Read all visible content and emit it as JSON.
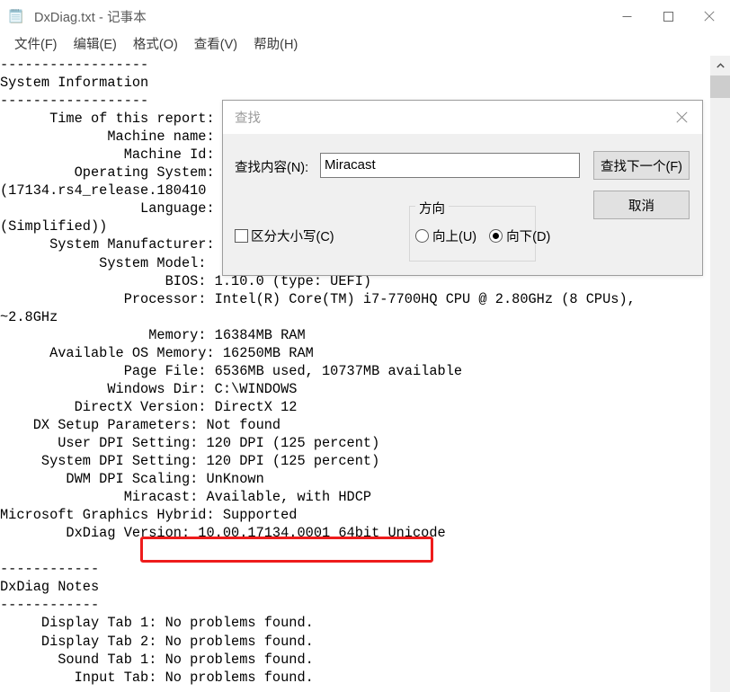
{
  "window": {
    "title": "DxDiag.txt - 记事本",
    "icon": "notepad-icon",
    "controls": {
      "minimize": "minimize-icon",
      "maximize": "maximize-icon",
      "close": "close-icon"
    }
  },
  "menubar": {
    "items": [
      {
        "label": "文件(F)"
      },
      {
        "label": "编辑(E)"
      },
      {
        "label": "格式(O)"
      },
      {
        "label": "查看(V)"
      },
      {
        "label": "帮助(H)"
      }
    ]
  },
  "document": {
    "lines": [
      "------------------",
      "System Information",
      "------------------",
      "      Time of this report:",
      "             Machine name:",
      "               Machine Id:",
      "         Operating System:",
      "(17134.rs4_release.180410",
      "                 Language:",
      "(Simplified))",
      "      System Manufacturer:",
      "            System Model:",
      "                    BIOS: 1.10.0 (type: UEFI)",
      "               Processor: Intel(R) Core(TM) i7-7700HQ CPU @ 2.80GHz (8 CPUs),",
      "~2.8GHz",
      "                  Memory: 16384MB RAM",
      "      Available OS Memory: 16250MB RAM",
      "               Page File: 6536MB used, 10737MB available",
      "             Windows Dir: C:\\WINDOWS",
      "         DirectX Version: DirectX 12",
      "    DX Setup Parameters: Not found",
      "       User DPI Setting: 120 DPI (125 percent)",
      "     System DPI Setting: 120 DPI (125 percent)",
      "        DWM DPI Scaling: UnKnown",
      "               Miracast: Available, with HDCP",
      "Microsoft Graphics Hybrid: Supported",
      "        DxDiag Version: 10.00.17134.0001 64bit Unicode",
      "",
      "------------",
      "DxDiag Notes",
      "------------",
      "     Display Tab 1: No problems found.",
      "     Display Tab 2: No problems found.",
      "       Sound Tab 1: No problems found.",
      "         Input Tab: No problems found."
    ],
    "highlight": {
      "name": "miracast-highlight",
      "color": "#ee1c1c",
      "text": "Miracast: Available, with HDCP"
    }
  },
  "scrollbar": {
    "up_arrow": "chevron-up-icon",
    "thumb": "scroll-thumb"
  },
  "find_dialog": {
    "title": "查找",
    "close": "close-icon",
    "find_what_label": "查找内容(N):",
    "find_what_value": "Miracast",
    "find_what_placeholder": "",
    "find_next_label": "查找下一个(F)",
    "cancel_label": "取消",
    "match_case_label": "区分大小写(C)",
    "match_case_checked": false,
    "direction_group_label": "方向",
    "direction_options": [
      {
        "label": "向上(U)",
        "selected": false
      },
      {
        "label": "向下(D)",
        "selected": true
      }
    ]
  }
}
